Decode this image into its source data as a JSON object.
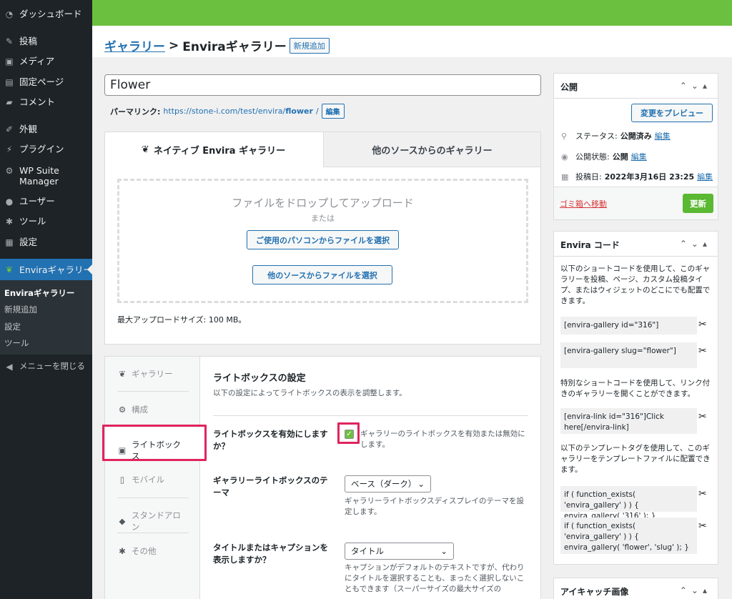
{
  "sidebar": {
    "items": [
      {
        "icon": "dashboard-icon",
        "label": "ダッシュボード"
      },
      {
        "icon": "pin-icon",
        "label": "投稿"
      },
      {
        "icon": "media-icon",
        "label": "メディア"
      },
      {
        "icon": "page-icon",
        "label": "固定ページ"
      },
      {
        "icon": "comment-icon",
        "label": "コメント"
      },
      {
        "icon": "brush-icon",
        "label": "外観"
      },
      {
        "icon": "plugin-icon",
        "label": "プラグイン"
      },
      {
        "icon": "gear-icon",
        "label": "WP Suite Manager"
      },
      {
        "icon": "user-icon",
        "label": "ユーザー"
      },
      {
        "icon": "wrench-icon",
        "label": "ツール"
      },
      {
        "icon": "settings-icon",
        "label": "設定"
      },
      {
        "icon": "leaf-icon",
        "label": "Enviraギャラリー"
      }
    ],
    "submenu": [
      "Enviraギャラリー",
      "新規追加",
      "設定",
      "ツール"
    ],
    "collapse": "メニューを閉じる"
  },
  "header": {
    "breadcrumb_link": "ギャラリー",
    "separator": ">",
    "breadcrumb_current": "Enviraギャラリー",
    "add_new": "新規追加"
  },
  "post": {
    "title": "Flower",
    "permalink_label": "パーマリンク:",
    "permalink_base": "https://stone-i.com/test/envira/",
    "permalink_slug": "flower",
    "permalink_end": "/",
    "edit_label": "編集"
  },
  "upload": {
    "tab_native": "ネイティブ Envira ギャラリー",
    "tab_other": "他のソースからのギャラリー",
    "drop_text": "ファイルをドロップしてアップロード",
    "or": "または",
    "btn_computer": "ご使用のパソコンからファイルを選択",
    "btn_other": "他のソースからファイルを選択",
    "max_size": "最大アップロードサイズ: 100 MB。"
  },
  "settings": {
    "tabs": [
      {
        "icon": "leaf-icon",
        "label": "ギャラリー"
      },
      {
        "icon": "gear-icon",
        "label": "構成"
      },
      {
        "icon": "lightbox-icon",
        "label": "ライトボックス"
      },
      {
        "icon": "mobile-icon",
        "label": "モバイル"
      },
      {
        "icon": "standalone-icon",
        "label": "スタンドアロン"
      },
      {
        "icon": "wrench-icon",
        "label": "その他"
      }
    ],
    "section_title": "ライトボックスの設定",
    "section_desc": "以下の設定によってライトボックスの表示を調整します。",
    "enable_label": "ライトボックスを有効にしますか？",
    "enable_help": "ギャラリーのライトボックスを有効または無効にします。",
    "enable_checked": true,
    "theme_label": "ギャラリーライトボックスのテーマ",
    "theme_value": "ベース（ダーク）",
    "theme_help": "ギャラリーライトボックスディスプレイのテーマを設定します。",
    "caption_label": "タイトルまたはキャプションを表示しますか？",
    "caption_value": "タイトル",
    "caption_help": "キャプションがデフォルトのテキストですが、代わりにタイトルを選択することも、まったく選択しないこともできます（スーパーサイズの最大サイズの"
  },
  "publish": {
    "title": "公開",
    "preview_btn": "変更をプレビュー",
    "status_label": "ステータス:",
    "status_value": "公開済み",
    "visibility_label": "公開状態:",
    "visibility_value": "公開",
    "date_label": "投稿日:",
    "date_value": "2022年3月16日 23:25",
    "edit": "編集",
    "trash": "ゴミ箱へ移動",
    "update": "更新"
  },
  "envira_code": {
    "title": "Envira コード",
    "desc1": "以下のショートコードを使用して、このギャラリーを投稿、ページ、カスタム投稿タイプ、またはウィジェットのどこにでも配置できます。",
    "code1": "[envira-gallery id=\"316\"]",
    "code2": "[envira-gallery slug=\"flower\"]",
    "desc2": "特別なショートコードを使用して、リンク付きのギャラリーを開くことができます。",
    "code3": "[envira-link id=\"316\"]Click here[/envira-link]",
    "desc3": "以下のテンプレートタグを使用して、このギャラリーをテンプレートファイルに配置できます。",
    "code4": "if ( function_exists( 'envira_gallery' ) ) { envira_gallery( '316' ); }",
    "code5": "if ( function_exists( 'envira_gallery' ) ) { envira_gallery( 'flower', 'slug' ); }"
  },
  "featured": {
    "title": "アイキャッチ画像"
  },
  "colors": {
    "accent": "#2271b1",
    "topbar": "#6cc040",
    "update": "#5bb832",
    "highlight": "#e0245e"
  }
}
